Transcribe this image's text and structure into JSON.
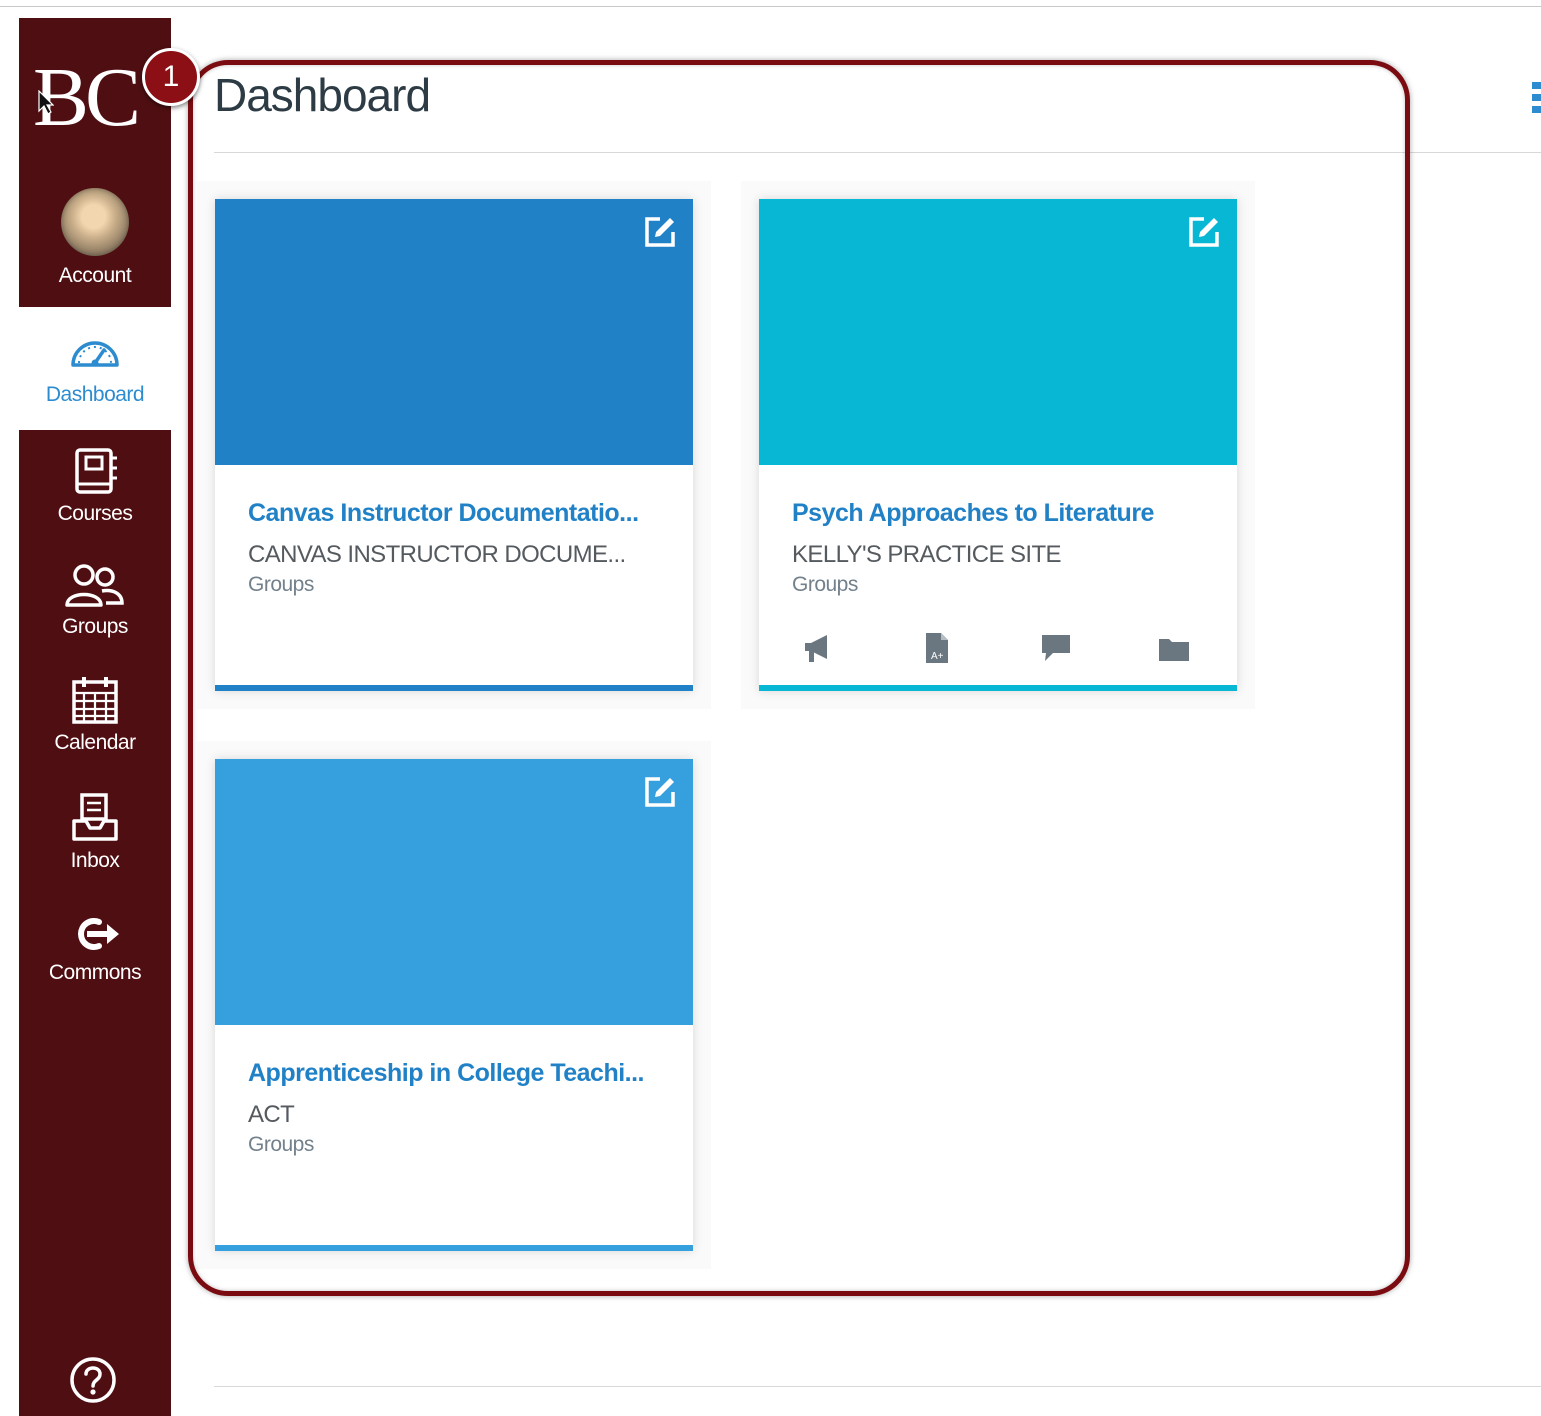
{
  "app": {
    "logo_text": "BC"
  },
  "nav": {
    "items": [
      {
        "id": "account",
        "label": "Account",
        "icon": "avatar"
      },
      {
        "id": "dashboard",
        "label": "Dashboard",
        "icon": "speedometer-icon",
        "active": true
      },
      {
        "id": "courses",
        "label": "Courses",
        "icon": "courses-icon"
      },
      {
        "id": "groups",
        "label": "Groups",
        "icon": "groups-icon"
      },
      {
        "id": "calendar",
        "label": "Calendar",
        "icon": "calendar-icon"
      },
      {
        "id": "inbox",
        "label": "Inbox",
        "icon": "inbox-icon"
      },
      {
        "id": "commons",
        "label": "Commons",
        "icon": "commons-icon"
      }
    ],
    "help_icon": "help-icon"
  },
  "callout": {
    "number": "1"
  },
  "dashboard": {
    "title": "Dashboard",
    "options_icon": "dashboard-options-icon"
  },
  "cards": [
    {
      "title": "Canvas Instructor Documentatio...",
      "code": "CANVAS INSTRUCTOR DOCUME...",
      "term": "Groups",
      "color": "#2181c6",
      "action_icons": []
    },
    {
      "title": "Psych Approaches to Literature",
      "code": "KELLY'S PRACTICE SITE",
      "term": "Groups",
      "color": "#07b7d3",
      "action_icons": [
        "announcements-icon",
        "assignments-icon",
        "discussions-icon",
        "files-icon"
      ]
    },
    {
      "title": "Apprenticeship in College Teachi...",
      "code": "ACT",
      "term": "Groups",
      "color": "#35a0dd",
      "action_icons": []
    }
  ],
  "colors": {
    "nav_bg": "#4f0f12",
    "link_blue": "#2d8ccf",
    "callout": "#7a0c11"
  }
}
